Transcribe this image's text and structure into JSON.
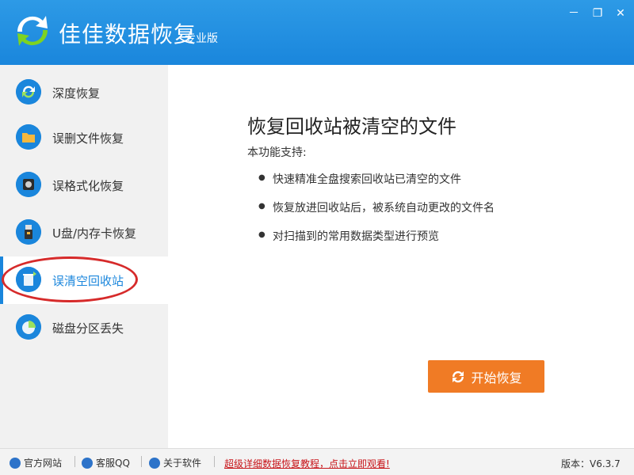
{
  "app": {
    "title": "佳佳数据恢复",
    "edition": "专业版",
    "minimize_glyph": "－",
    "restore_glyph": "❐",
    "close_glyph": "✕"
  },
  "sidebar": {
    "items": [
      {
        "label": "深度恢复",
        "icon": "refresh-icon"
      },
      {
        "label": "误删文件恢复",
        "icon": "folder-icon"
      },
      {
        "label": "误格式化恢复",
        "icon": "disk-icon"
      },
      {
        "label": "U盘/内存卡恢复",
        "icon": "usb-icon"
      },
      {
        "label": "误清空回收站",
        "icon": "recycle-bin-icon",
        "active": true
      },
      {
        "label": "磁盘分区丢失",
        "icon": "partition-icon"
      }
    ]
  },
  "main": {
    "heading": "恢复回收站被清空的文件",
    "subheading": "本功能支持:",
    "bullets": [
      "快速精准全盘搜索回收站已清空的文件",
      "恢复放进回收站后，被系统自动更改的文件名",
      "对扫描到的常用数据类型进行预览"
    ],
    "start_button": "开始恢复"
  },
  "footer": {
    "website": "官方网站",
    "support_qq": "客服QQ",
    "about": "关于软件",
    "tutorial": "超级详细数据恢复教程，点击立即观看!",
    "version": "版本：V6.3.7"
  },
  "colors": {
    "accent": "#1a86dc",
    "button": "#f07b25",
    "link_red": "#c8151a",
    "highlight_ring": "#d62a2a"
  }
}
